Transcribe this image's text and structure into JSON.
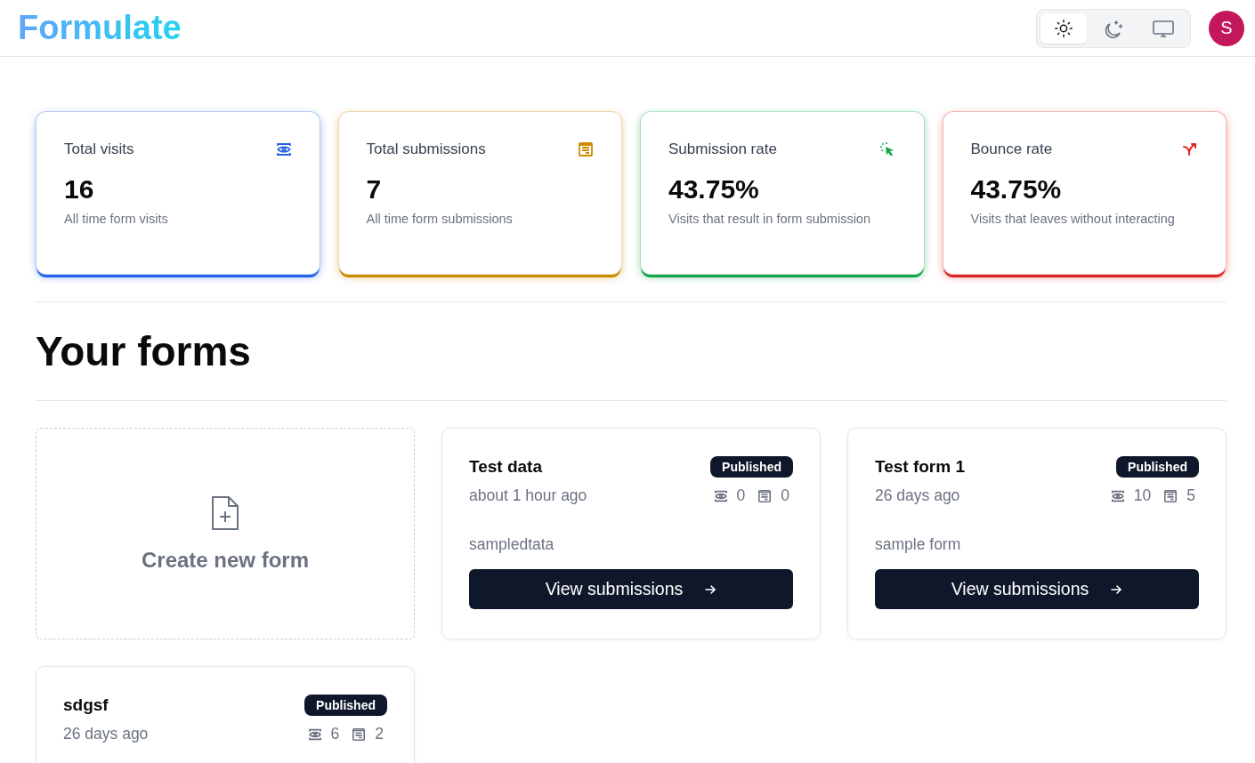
{
  "header": {
    "logo": "Formulate",
    "theme_options": [
      {
        "kind": "light",
        "selected": true
      },
      {
        "kind": "dark",
        "selected": false
      },
      {
        "kind": "system",
        "selected": false
      }
    ],
    "avatar": "S"
  },
  "stats": [
    {
      "kind": "visits",
      "title": "Total visits",
      "value": "16",
      "helper": "All time form visits",
      "color": "#2563eb"
    },
    {
      "kind": "submissions",
      "title": "Total submissions",
      "value": "7",
      "helper": "All time form submissions",
      "color": "#ca8a04"
    },
    {
      "kind": "rate",
      "title": "Submission rate",
      "value": "43.75%",
      "helper": "Visits that result in form submission",
      "color": "#16a34a"
    },
    {
      "kind": "bounce",
      "title": "Bounce rate",
      "value": "43.75%",
      "helper": "Visits that leaves without interacting",
      "color": "#dc2626"
    }
  ],
  "heading": "Your forms",
  "create_card": {
    "label": "Create new form"
  },
  "forms": [
    {
      "name": "Test data",
      "published": true,
      "badge": "Published",
      "time": "about 1 hour ago",
      "visits": "0",
      "submissions": "0",
      "description": "sampledtata",
      "button": "View submissions"
    },
    {
      "name": "Test form 1",
      "published": true,
      "badge": "Published",
      "time": "26 days ago",
      "visits": "10",
      "submissions": "5",
      "description": "sample form",
      "button": "View submissions"
    },
    {
      "name": "sdgsf",
      "published": true,
      "badge": "Published",
      "time": "26 days ago",
      "visits": "6",
      "submissions": "2"
    }
  ]
}
